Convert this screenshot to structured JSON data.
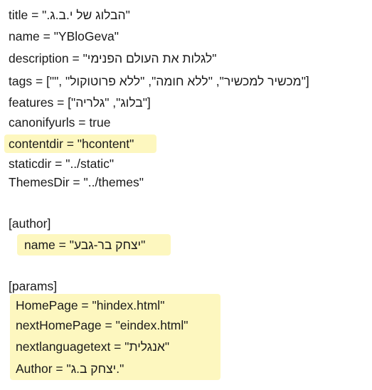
{
  "config": {
    "lines": [
      "title = \".הבלוג של י.ב.ג\"",
      "name = \"YBloGeva\"",
      "description = \"לגלות את העולם הפנימי\"",
      "tags = [\"\", \"מכשיר למכשיר\", \"ללא חומה\", \"ללא פרוטוקול\"]",
      "features = [\"בלוג\", \"גלריה\"]",
      "canonifyurls = true",
      "contentdir = \"hcontent\"",
      "staticdir = \"../static\"",
      "ThemesDir = \"../themes\""
    ],
    "author_section": {
      "header": "[author]",
      "name_line": "name = \"יצחק בר-גבע\""
    },
    "params_section": {
      "header": "[params]",
      "lines": [
        "HomePage = \"hindex.html\"",
        "nextHomePage = \"eindex.html\"",
        "nextlanguagetext = \"אנגלית\"",
        "Author = \"יצחק ב.ג.\""
      ]
    },
    "highlight_color": "#fdf7bf"
  }
}
